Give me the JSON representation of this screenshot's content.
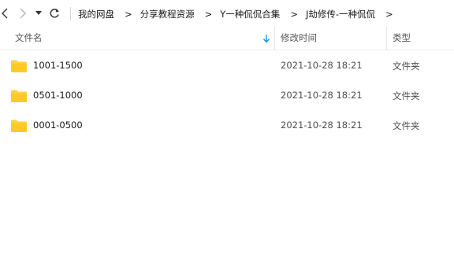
{
  "address": {
    "breadcrumbs": [
      "我的网盘",
      "分享教程资源",
      "Y一种侃侃合集",
      "J劫修传-一种侃侃"
    ],
    "separator": ">"
  },
  "columns": {
    "name": "文件名",
    "modified": "修改时间",
    "type": "类型"
  },
  "files": [
    {
      "name": "1001-1500",
      "modified": "2021-10-28 18:21",
      "type": "文件夹"
    },
    {
      "name": "0501-1000",
      "modified": "2021-10-28 18:21",
      "type": "文件夹"
    },
    {
      "name": "0001-0500",
      "modified": "2021-10-28 18:21",
      "type": "文件夹"
    }
  ],
  "icons": {
    "back": "back-arrow-icon",
    "forward": "forward-arrow-icon",
    "history": "dropdown-caret-icon",
    "refresh": "refresh-icon",
    "folder": "folder-icon",
    "sort": "sort-down-icon"
  },
  "colors": {
    "folder": "#ffd23f",
    "sort_arrow": "#1e90e8"
  }
}
